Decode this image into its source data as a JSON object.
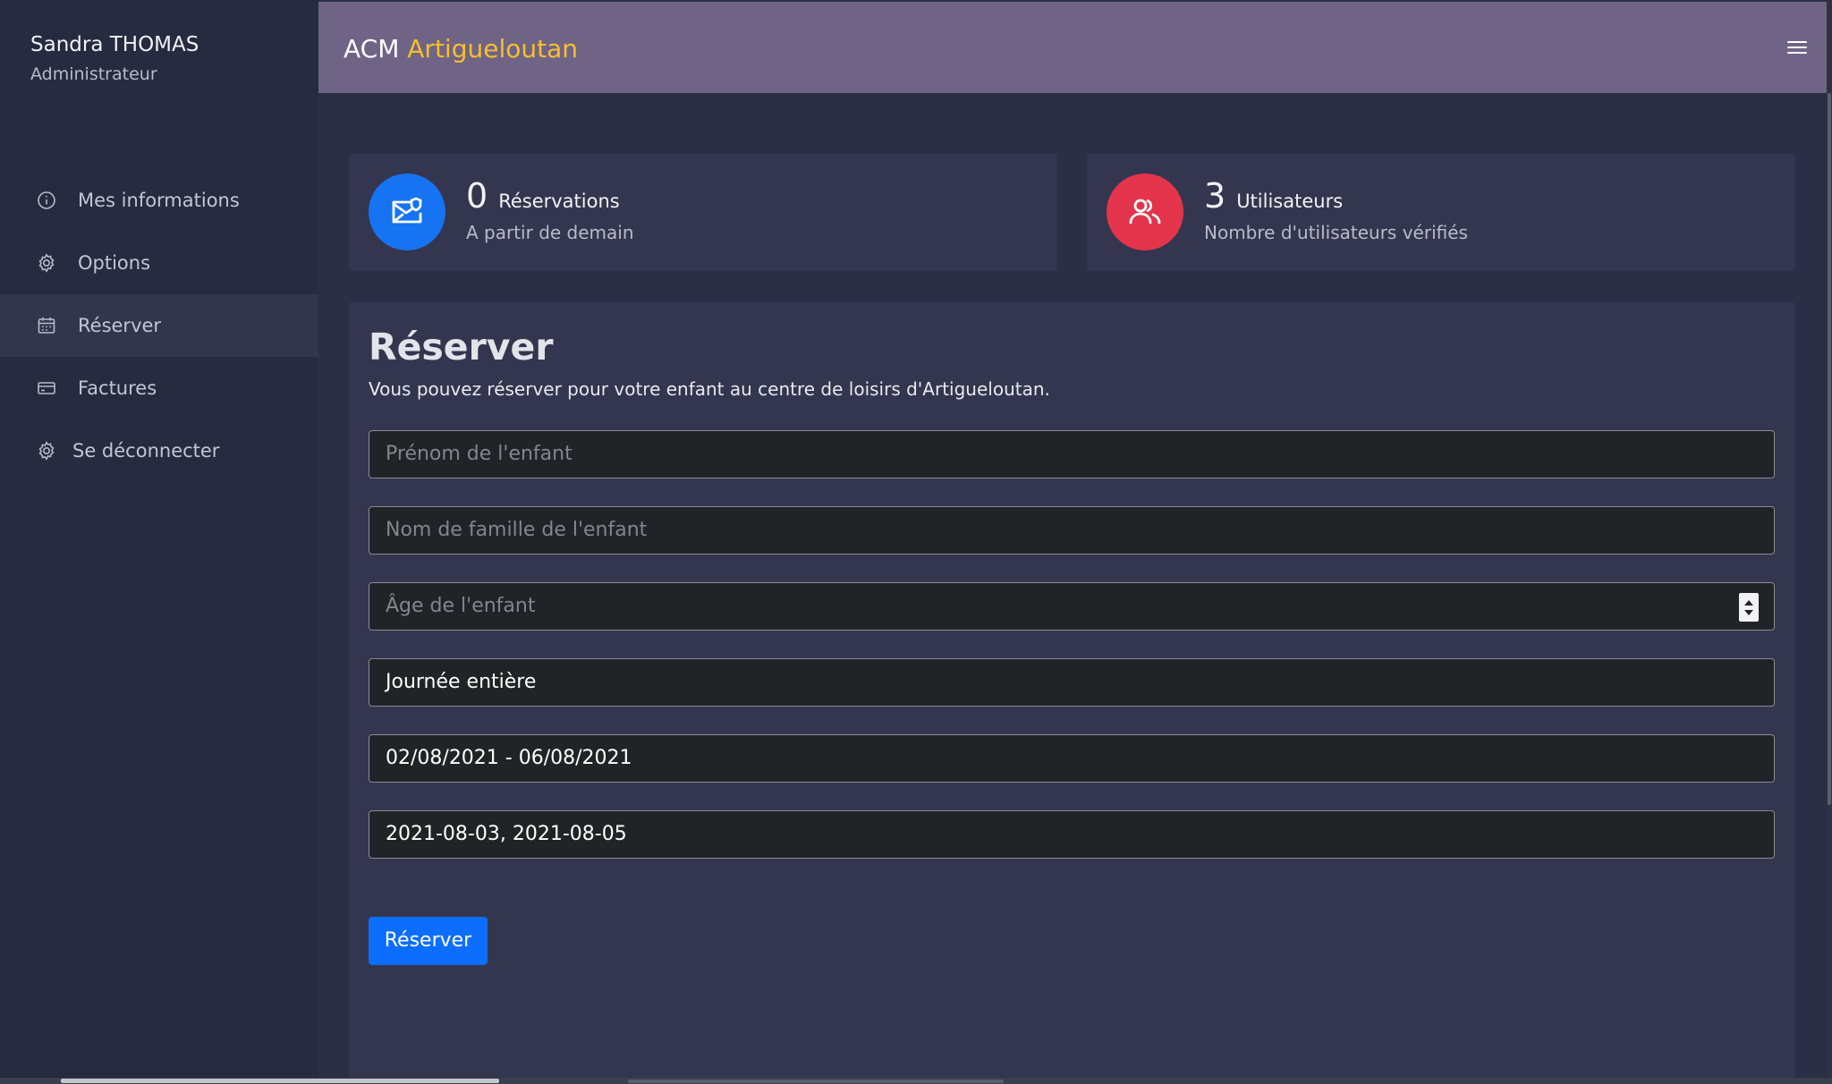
{
  "user": {
    "name": "Sandra THOMAS",
    "role": "Administrateur"
  },
  "sidebar": {
    "items": [
      {
        "label": "Mes informations",
        "icon": "info-icon",
        "active": false
      },
      {
        "label": "Options",
        "icon": "gear-icon",
        "active": false
      },
      {
        "label": "Réserver",
        "icon": "calendar-icon",
        "active": true
      },
      {
        "label": "Factures",
        "icon": "credit-card-icon",
        "active": false
      },
      {
        "label": "Se déconnecter",
        "icon": "gear-icon",
        "active": false
      }
    ]
  },
  "header": {
    "brand_prefix": "ACM",
    "brand_name": "Artigueloutan",
    "menu_icon": "hamburger-menu-icon"
  },
  "stats": {
    "reservations": {
      "count": "0",
      "label": "Réservations",
      "sub": "A partir de demain",
      "icon": "envelope-icon",
      "color": "#1673f1"
    },
    "users": {
      "count": "3",
      "label": "Utilisateurs",
      "sub": "Nombre d'utilisateurs vérifiés",
      "icon": "users-icon",
      "color": "#e3344c"
    }
  },
  "form": {
    "title": "Réserver",
    "description": "Vous pouvez réserver pour votre enfant au centre de loisirs d'Artigueloutan.",
    "first_name_placeholder": "Prénom de l'enfant",
    "last_name_placeholder": "Nom de famille de l'enfant",
    "age_placeholder": "Âge de l'enfant",
    "duration_value": "Journée entière",
    "week_value": "02/08/2021 - 06/08/2021",
    "dates_value": "2021-08-03, 2021-08-05",
    "submit_label": "Réserver"
  },
  "colors": {
    "header_bg": "#6f6485",
    "brand_accent": "#f7be2f",
    "primary": "#0d6efd"
  }
}
